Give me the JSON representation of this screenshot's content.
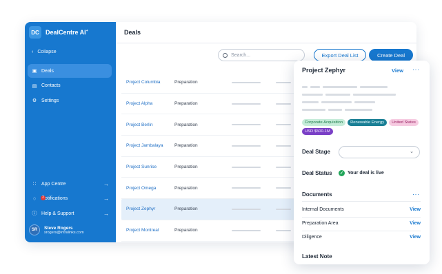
{
  "brand": {
    "logo": "DC",
    "name": "DealCentre AI",
    "mark": "+"
  },
  "sidebar": {
    "collapse": "Collapse",
    "items": [
      {
        "label": "Deals",
        "icon": "briefcase-icon",
        "active": true
      },
      {
        "label": "Contacts",
        "icon": "contact-card-icon",
        "active": false
      },
      {
        "label": "Settings",
        "icon": "gear-icon",
        "active": false
      }
    ],
    "bottom": [
      {
        "label": "App Centre",
        "icon": "grid-icon"
      },
      {
        "label": "Notifications",
        "icon": "bell-icon",
        "badge": "2"
      },
      {
        "label": "Help & Support",
        "icon": "help-circle-icon"
      }
    ],
    "user": {
      "initials": "SR",
      "name": "Steve Rogers",
      "email": "srogers@intralinks.com"
    }
  },
  "main": {
    "title": "Deals",
    "search_placeholder": "Search...",
    "export_label": "Export Deal List",
    "create_label": "Create Deal",
    "rows": [
      {
        "name": "Project Columbia",
        "stage": "Preparation"
      },
      {
        "name": "Project Alpha",
        "stage": "Preparation"
      },
      {
        "name": "Project Berlin",
        "stage": "Preparation"
      },
      {
        "name": "Project Jambalaya",
        "stage": "Preparation"
      },
      {
        "name": "Project Sunrise",
        "stage": "Preparation"
      },
      {
        "name": "Project Omega",
        "stage": "Preparation"
      },
      {
        "name": "Project Zephyr",
        "stage": "Preparation",
        "selected": true
      },
      {
        "name": "Project Montreal",
        "stage": "Preparation"
      }
    ]
  },
  "panel": {
    "title": "Project Zephyr",
    "view": "View",
    "tags": [
      {
        "label": "Corporate Acquisition",
        "style": "green"
      },
      {
        "label": "Renewable Energy",
        "style": "teal"
      },
      {
        "label": "United States",
        "style": "pink"
      },
      {
        "label": "USD $500-1M",
        "style": "purple"
      }
    ],
    "deal_stage_label": "Deal Stage",
    "deal_status_label": "Deal Status",
    "deal_status_value": "Your deal is live",
    "documents_label": "Documents",
    "documents": [
      {
        "name": "Internal Documents",
        "action": "View"
      },
      {
        "name": "Preparation Area",
        "action": "View"
      },
      {
        "name": "Diligence",
        "action": "View"
      }
    ],
    "latest_note_label": "Latest Note"
  },
  "colors": {
    "primary": "#1778cf",
    "sidebar_active": "#3a8fe0",
    "selected_row": "#e4effa",
    "success": "#22a55a"
  }
}
